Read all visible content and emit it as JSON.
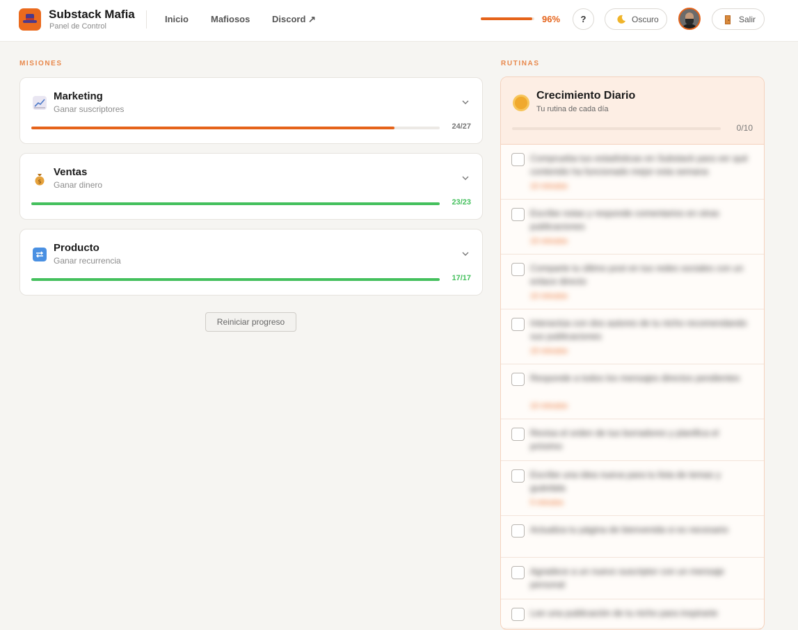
{
  "header": {
    "brand_title": "Substack Mafia",
    "brand_subtitle": "Panel de Control",
    "nav": [
      "Inicio",
      "Mafiosos",
      "Discord ↗"
    ],
    "progress_percent": 96,
    "progress_label": "96%",
    "help_label": "?",
    "theme_label": "Oscuro",
    "theme_icon": "moon-icon",
    "logout_label": "Salir",
    "logout_icon": "door-icon",
    "accent_color": "#e5631a"
  },
  "missions": {
    "section_label": "MISIONES",
    "items": [
      {
        "title": "Marketing",
        "subtitle": "Ganar suscriptores",
        "icon": "chart-up-icon",
        "done": 24,
        "total": 27,
        "count_label": "24/27",
        "bar_color": "#e5631a",
        "count_color": "#777777"
      },
      {
        "title": "Ventas",
        "subtitle": "Ganar dinero",
        "icon": "money-bag-icon",
        "done": 23,
        "total": 23,
        "count_label": "23/23",
        "bar_color": "#44c05d",
        "count_color": "#44c05d"
      },
      {
        "title": "Producto",
        "subtitle": "Ganar recurrencia",
        "icon": "repeat-icon",
        "done": 17,
        "total": 17,
        "count_label": "17/17",
        "bar_color": "#44c05d",
        "count_color": "#44c05d"
      }
    ],
    "reset_label": "Reiniciar progreso"
  },
  "routines": {
    "section_label": "RUTINAS",
    "title": "Crecimiento Diario",
    "subtitle": "Tu rutina de cada día",
    "icon": "sun-icon",
    "done": 0,
    "total": 10,
    "count_label": "0/10",
    "tasks": [
      {
        "text": "Comprueba tus estadísticas en Substack para ver qué contenido ha funcionado mejor esta semana",
        "tag": "10 minutos"
      },
      {
        "text": "Escribe notas y responde comentarios en otras publicaciones",
        "tag": "15 minutos"
      },
      {
        "text": "Comparte tu último post en tus redes sociales con un enlace directo",
        "tag": "10 minutos"
      },
      {
        "text": "Interactúa con dos autores de tu nicho recomendando sus publicaciones",
        "tag": "15 minutos"
      },
      {
        "text": "Responde a todos los mensajes directos pendientes",
        "tag": "10 minutos"
      },
      {
        "text": "Revisa el orden de tus borradores y planifica el próximo",
        "tag": ""
      },
      {
        "text": "Escribe una idea nueva para tu lista de temas y guárdala",
        "tag": "5 minutos"
      },
      {
        "text": "Actualiza tu página de bienvenida si es necesario",
        "tag": ""
      },
      {
        "text": "Agradece a un nuevo suscriptor con un mensaje personal",
        "tag": ""
      },
      {
        "text": "Lee una publicación de tu nicho para inspirarte",
        "tag": ""
      }
    ]
  }
}
